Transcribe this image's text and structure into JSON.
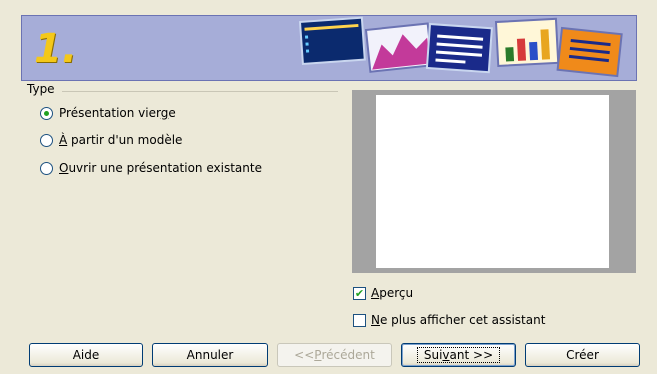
{
  "banner": {
    "step_number": "1."
  },
  "type_group": {
    "legend": "Type",
    "options": [
      {
        "pre": "Présentation vier",
        "key": "g",
        "post": "e",
        "selected": true
      },
      {
        "pre": "",
        "key": "À",
        "post": " partir d'un modèle",
        "selected": false
      },
      {
        "pre": "",
        "key": "O",
        "post": "uvrir une présentation existante",
        "selected": false
      }
    ]
  },
  "checkboxes": {
    "preview": {
      "pre": "",
      "key": "A",
      "post": "perçu",
      "checked": true
    },
    "dont_show": {
      "pre": "",
      "key": "N",
      "post": "e plus afficher cet assistant",
      "checked": false
    }
  },
  "buttons": {
    "help": "Aide",
    "cancel": "Annuler",
    "back": {
      "pre": "<< ",
      "key": "P",
      "post": "récédent",
      "enabled": false
    },
    "next": {
      "pre": "Sui",
      "key": "v",
      "post": "ant >>",
      "enabled": true
    },
    "create": "Créer"
  },
  "colors": {
    "banner_bg": "#a6add8",
    "check_green": "#21a121",
    "step_number": "#f4c81a"
  }
}
